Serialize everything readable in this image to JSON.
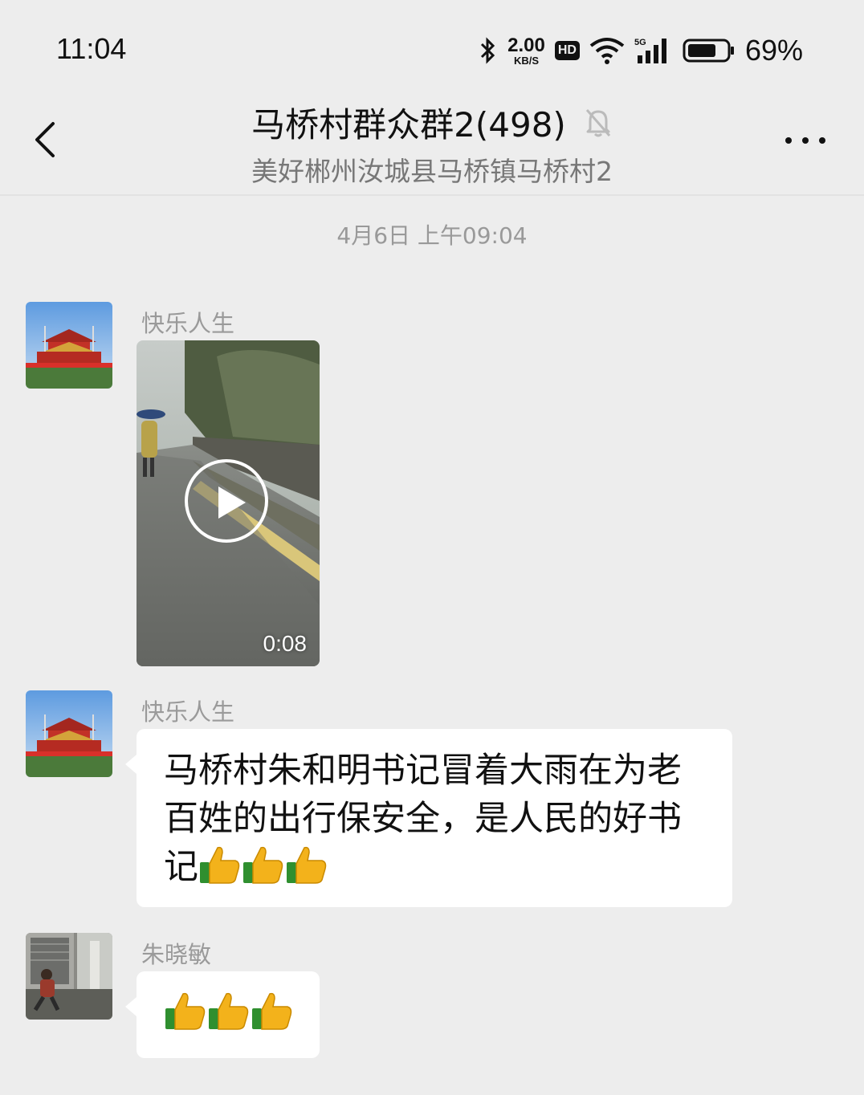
{
  "status_bar": {
    "time": "11:04",
    "net_speed_value": "2.00",
    "net_speed_unit": "KB/S",
    "hd_badge": "HD",
    "network_type": "5G",
    "battery_percent": "69%"
  },
  "header": {
    "title": "马桥村群众群2(498)",
    "subtitle": "美好郴州汝城县马桥镇马桥村2",
    "muted": true
  },
  "chat": {
    "timestamp": "4月6日 上午09:04",
    "messages": [
      {
        "sender": "快乐人生",
        "type": "video",
        "duration": "0:08"
      },
      {
        "sender": "快乐人生",
        "type": "text",
        "line1": "马桥村朱和明书记冒着大雨在为老",
        "line2": "百姓的出行保安全，是人民的好书",
        "line3": "记",
        "emoji": "thumbs-up",
        "emoji_count": 3
      },
      {
        "sender": "朱晓敏",
        "type": "text",
        "emoji": "thumbs-up",
        "emoji_count": 3
      }
    ]
  },
  "colors": {
    "background": "#ededed",
    "bubble": "#ffffff",
    "sender_name": "#9a9a9a",
    "subtitle": "#777777"
  }
}
